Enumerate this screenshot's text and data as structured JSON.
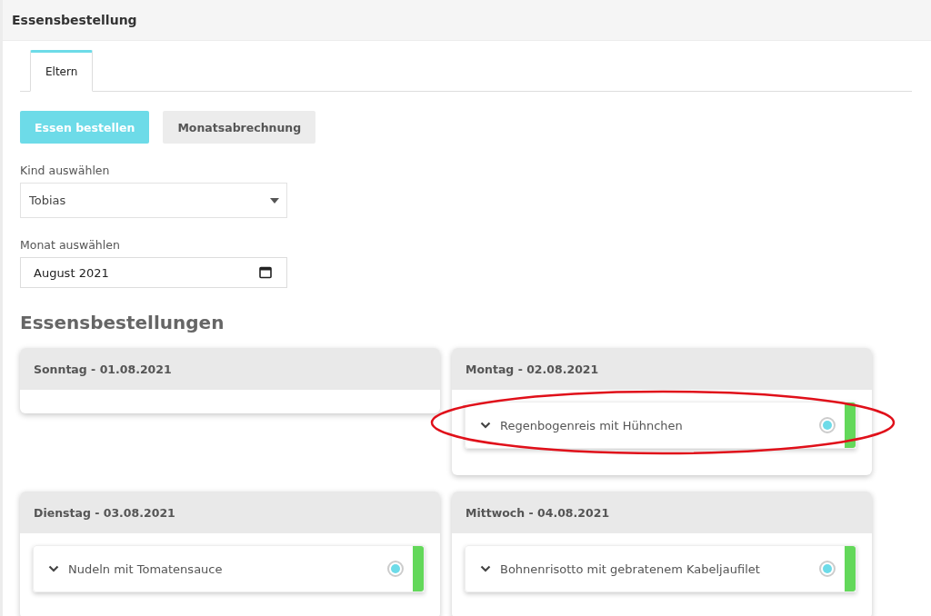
{
  "page": {
    "title": "Essensbestellung"
  },
  "tabs": [
    {
      "label": "Eltern",
      "selected": true
    }
  ],
  "buttons": [
    {
      "label": "Essen bestellen",
      "selected": true
    },
    {
      "label": "Monatsabrechnung",
      "selected": false
    }
  ],
  "child_select": {
    "label": "Kind auswählen",
    "value": "Tobias"
  },
  "month_input": {
    "label": "Monat auswählen",
    "value": "August 2021"
  },
  "orders_heading": "Essensbestellungen",
  "days": [
    {
      "title": "Sonntag - 01.08.2021"
    },
    {
      "title": "Montag - 02.08.2021",
      "meals": [
        {
          "name": "Regenbogenreis mit Hühnchen",
          "selected": true,
          "color": "#63d85a"
        }
      ]
    },
    {
      "title": "Dienstag - 03.08.2021",
      "meals": [
        {
          "name": "Nudeln mit Tomatensauce",
          "selected": true,
          "color": "#63d85a"
        }
      ]
    },
    {
      "title": "Mittwoch - 04.08.2021",
      "meals": [
        {
          "name": "Bohnenrisotto mit gebratenem Kabeljaufilet",
          "selected": true,
          "color": "#63d85a"
        }
      ]
    }
  ]
}
